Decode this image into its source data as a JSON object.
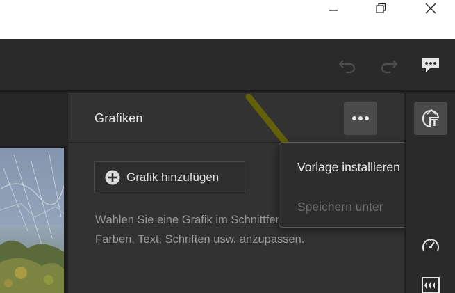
{
  "window": {
    "controls": [
      "minimize",
      "restore",
      "close"
    ]
  },
  "toolbar": {
    "icons": [
      "undo-icon",
      "redo-icon",
      "feedback-icon"
    ]
  },
  "panel": {
    "title": "Grafiken",
    "add_button_label": "Grafik hinzufügen",
    "description_line1": "Wählen Sie eine Grafik im Schnittfenster aus, um",
    "description_line2": "Farben, Text, Schriften usw. anzupassen."
  },
  "more_menu": {
    "items": [
      {
        "label": "Vorlage installieren",
        "enabled": true
      },
      {
        "label": "Speichern unter",
        "enabled": false
      }
    ]
  },
  "rail": {
    "icons": [
      "graphics-icon",
      "speed-icon",
      "audio-track-icon"
    ]
  },
  "colors": {
    "panel_bg": "#323232",
    "toolbar_bg": "#2a2a2a",
    "menu_bg": "#2d2d2d",
    "active_text": "#e8e8e8",
    "disabled_text": "#6f6f6f",
    "pointer_trail": "#6b6a00"
  }
}
